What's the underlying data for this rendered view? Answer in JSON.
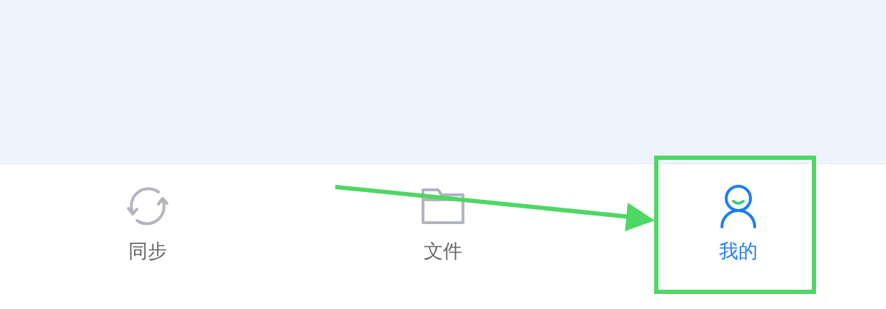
{
  "tabs": [
    {
      "kind": "sync",
      "label": "同步",
      "selected": false
    },
    {
      "kind": "folder",
      "label": "文件",
      "selected": false
    },
    {
      "kind": "profile",
      "label": "我的",
      "selected": true
    }
  ],
  "annotation_arrow": {
    "color": "#4fd764"
  },
  "annotation_frame": {
    "color": "#4fd764"
  }
}
